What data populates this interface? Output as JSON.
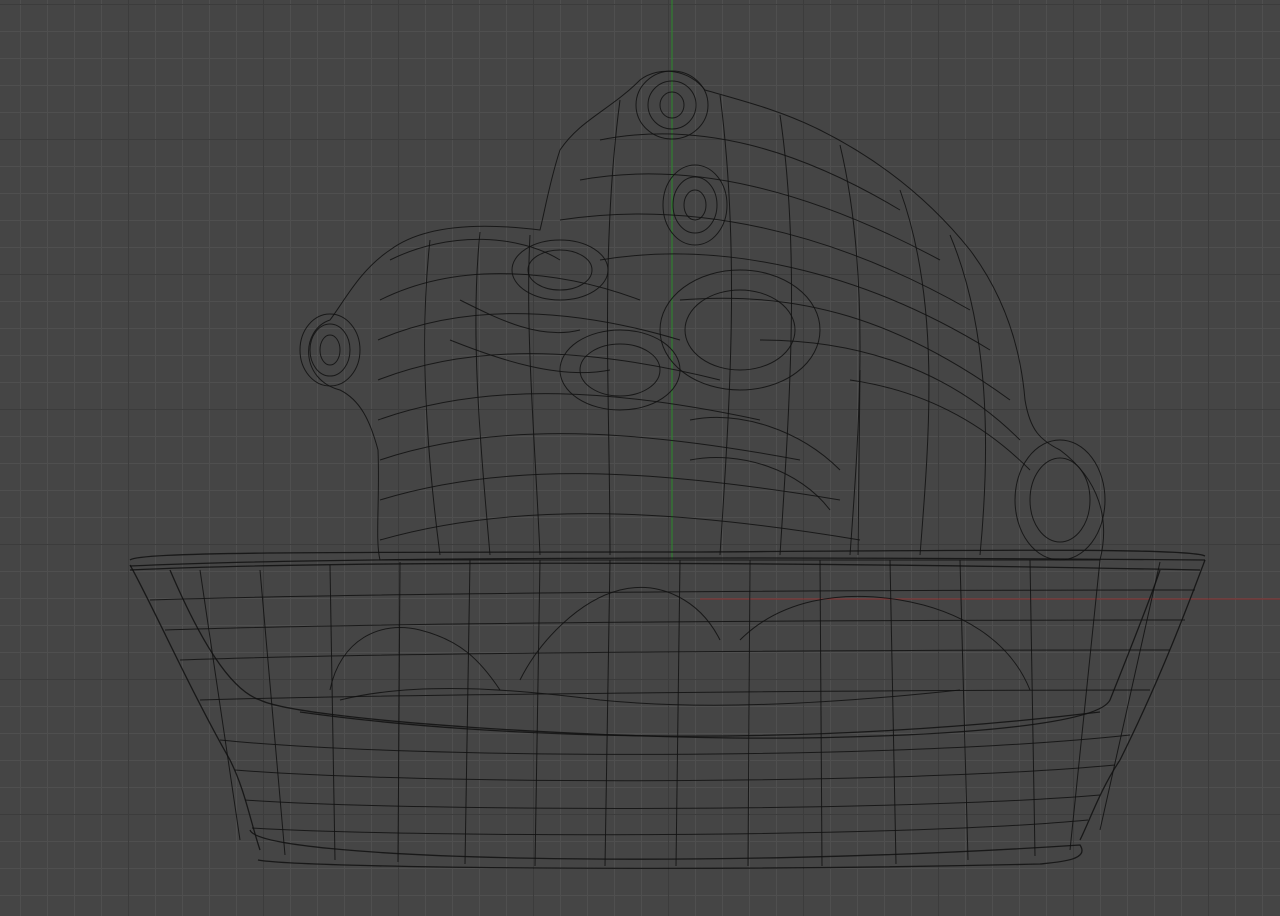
{
  "viewport": {
    "mode": "wireframe",
    "background_color": "#454545",
    "grid_minor_color": "#4f4f4f",
    "grid_major_color": "#3c3c3c",
    "axes": {
      "x_axis_color": "#8a3030",
      "y_axis_color": "#2a8a2a"
    },
    "wire_color": "#101010"
  },
  "model": {
    "objects": [
      "sleeping-figure-mesh",
      "bowl-mesh"
    ]
  }
}
